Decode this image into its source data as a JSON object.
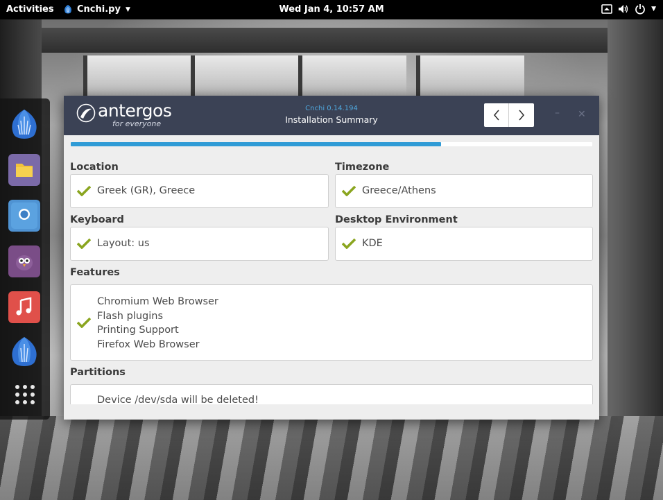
{
  "topbar": {
    "activities": "Activities",
    "app_name": "Cnchi.py",
    "clock": "Wed Jan  4, 10:57 AM"
  },
  "dock": {
    "items": [
      "antergos-icon",
      "files-icon",
      "browser-icon",
      "pidgin-icon",
      "music-icon",
      "cnchi-icon",
      "app-grid-icon"
    ]
  },
  "window": {
    "logo_word": "antergos",
    "logo_tagline": "for everyone",
    "version": "Cnchi  0.14.194",
    "title": "Installation Summary",
    "progress": 0.71
  },
  "summary": {
    "location_label": "Location",
    "location_value": "Greek (GR), Greece",
    "timezone_label": "Timezone",
    "timezone_value": "Greece/Athens",
    "keyboard_label": "Keyboard",
    "keyboard_value": "Layout: us",
    "desktop_label": "Desktop Environment",
    "desktop_value": "KDE",
    "features_label": "Features",
    "features": [
      "Chromium Web Browser",
      "Flash plugins",
      "Printing Support",
      "Firefox Web Browser"
    ],
    "partitions_label": "Partitions",
    "partitions_value": "Device /dev/sda will be deleted!"
  },
  "colors": {
    "header_bg": "#3b4255",
    "accent_blue": "#2f9bd6",
    "check_green": "#8aa51f"
  }
}
